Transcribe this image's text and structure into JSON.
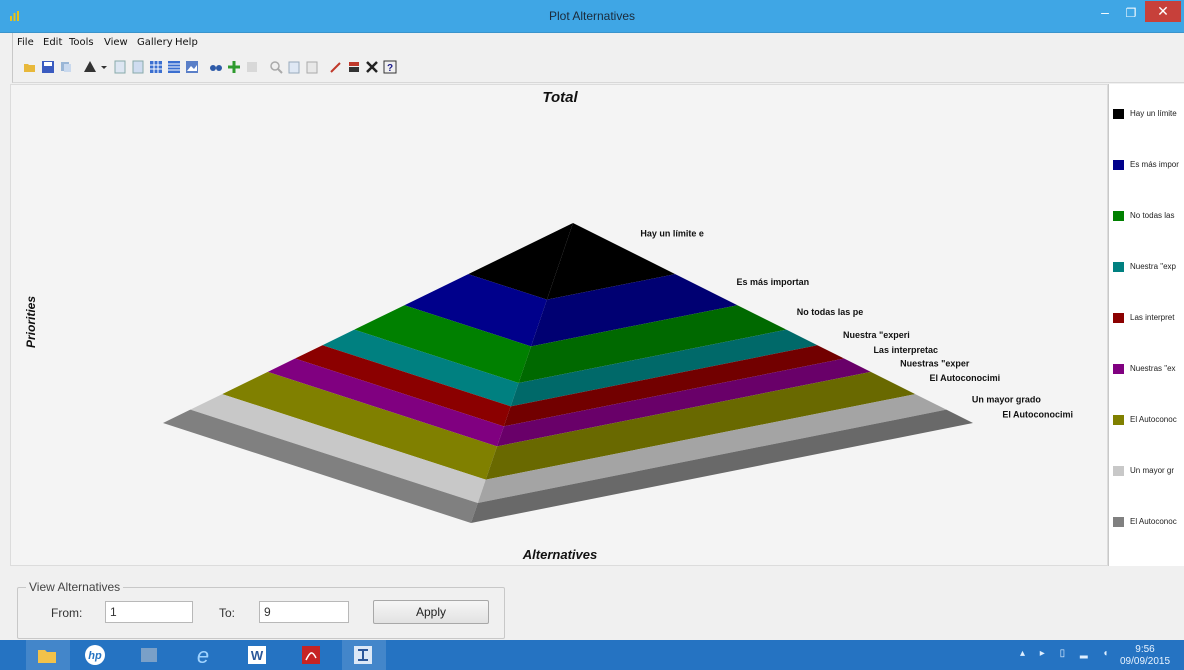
{
  "window": {
    "title": "Plot Alternatives"
  },
  "menu": [
    "File",
    "Edit",
    "Tools",
    "View",
    "Gallery",
    "Help"
  ],
  "toolbar_icons": [
    "open-icon",
    "save-icon",
    "copy-icon",
    "chart-type-icon",
    "page-icon",
    "page2-icon",
    "grid-icon",
    "table-icon",
    "image-icon",
    "binoculars-icon",
    "move-icon",
    "edit-icon",
    "zoom-icon",
    "print-icon",
    "preview-icon",
    "pen-icon",
    "color-icon",
    "delete-icon",
    "help-icon"
  ],
  "chart_data": {
    "type": "pyramid",
    "title": "Total",
    "xlabel": "Alternatives",
    "ylabel": "Priorities",
    "series": [
      {
        "label": "Hay un límite e",
        "legend": "Hay un límite",
        "color": "#000000"
      },
      {
        "label": "Es más importan",
        "legend": "Es más impor",
        "color": "#00008b"
      },
      {
        "label": "No todas las pe",
        "legend": "No todas las",
        "color": "#008000"
      },
      {
        "label": "Nuestra \"experi",
        "legend": "Nuestra \"exp",
        "color": "#008080"
      },
      {
        "label": "Las interpretac",
        "legend": "Las interpret",
        "color": "#8b0000"
      },
      {
        "label": "Nuestras \"exper",
        "legend": "Nuestras \"ex",
        "color": "#800080"
      },
      {
        "label": "El Autoconocimi",
        "legend": "El Autoconoc",
        "color": "#808000"
      },
      {
        "label": "Un mayor grado",
        "legend": "Un mayor gr",
        "color": "#c8c8c8"
      },
      {
        "label": "El Autoconocimi",
        "legend": "El Autoconoc",
        "color": "#808080"
      }
    ]
  },
  "view_alternatives": {
    "group_label": "View Alternatives",
    "from_label": "From:",
    "from_value": "1",
    "to_label": "To:",
    "to_value": "9",
    "apply_label": "Apply"
  },
  "taskbar": {
    "apps": [
      "file-explorer-icon",
      "hp-icon",
      "app-icon",
      "internet-explorer-icon",
      "word-icon",
      "acrobat-icon",
      "plot-app-icon"
    ],
    "time": "9:56",
    "date": "09/09/2015"
  }
}
